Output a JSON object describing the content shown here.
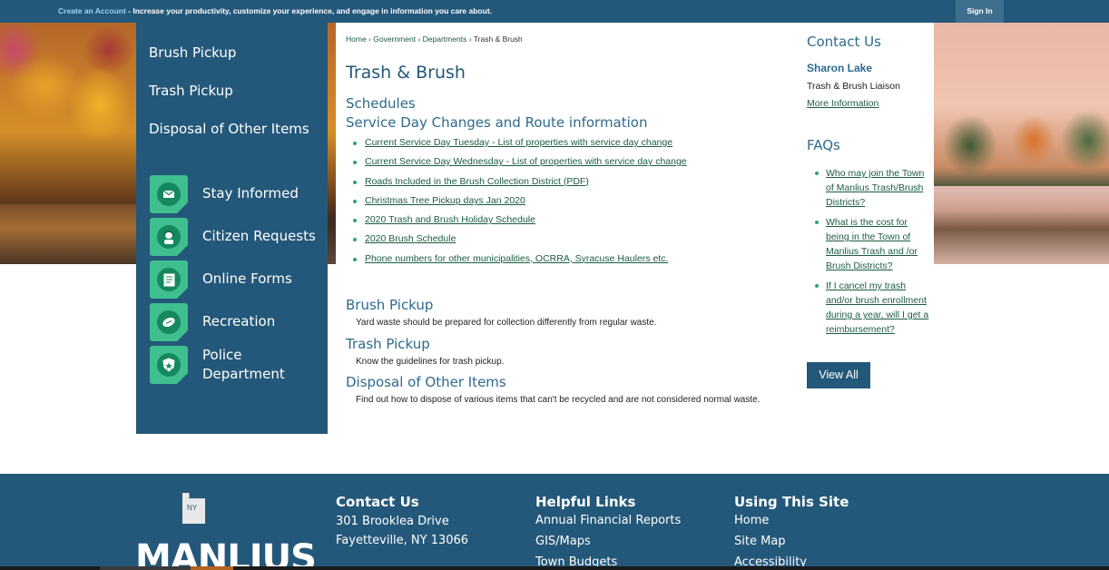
{
  "topbar": {
    "create_account": "Create an Account",
    "message": " - Increase your productivity, customize your experience, and engage in information you care about.",
    "sign_in": "Sign In"
  },
  "sidebar": {
    "links": [
      "Brush Pickup",
      "Trash Pickup",
      "Disposal of Other Items"
    ],
    "quick_links": [
      {
        "label": "Stay Informed",
        "icon": "envelope-icon"
      },
      {
        "label": "Citizen Requests",
        "icon": "headset-icon"
      },
      {
        "label": "Online Forms",
        "icon": "form-icon"
      },
      {
        "label": "Recreation",
        "icon": "football-icon"
      },
      {
        "label": "Police Department",
        "icon": "police-badge-icon"
      }
    ]
  },
  "breadcrumb": {
    "items": [
      "Home",
      "Government",
      "Departments"
    ],
    "current": "Trash & Brush",
    "separator": "›"
  },
  "main": {
    "title": "Trash & Brush",
    "schedules_heading": "Schedules",
    "route_heading": "Service Day Changes and Route information",
    "schedule_links": [
      "Current Service Day Tuesday - List of properties with service day change",
      "Current Service Day Wednesday - List of properties with service day change",
      "Roads Included in the Brush Collection District (PDF)",
      "Christmas Tree Pickup days Jan 2020",
      "2020 Trash and Brush Holiday Schedule",
      "2020 Brush Schedule",
      "Phone numbers for other municipalities, OCRRA, Syracuse Haulers etc."
    ],
    "sections": [
      {
        "heading": "Brush Pickup",
        "text": "Yard waste should be prepared for collection differently from regular waste."
      },
      {
        "heading": "Trash Pickup",
        "text": "Know the guidelines for trash pickup."
      },
      {
        "heading": "Disposal of Other Items",
        "text": "Find out how to dispose of various items that can't be recycled and are not considered normal waste."
      }
    ]
  },
  "contact": {
    "title": "Contact Us",
    "name": "Sharon Lake",
    "role": "Trash & Brush Liaison",
    "more": "More Information"
  },
  "faqs": {
    "title": "FAQs",
    "items": [
      "Who may join the Town of Manlius Trash/Brush Districts?",
      "What is the cost for being in the Town of Manlius Trash and /or Brush Districts?",
      "If I cancel my trash and/or brush enrollment during a year, will I get a reimbursement?"
    ],
    "view_all": "View All"
  },
  "footer": {
    "state_label": "NY",
    "logo_text": "MANLIUS",
    "contact_heading": "Contact Us",
    "address_line1": "301 Brooklea Drive",
    "address_line2": "Fayetteville, NY 13066",
    "helpful_heading": "Helpful Links",
    "helpful_links": [
      "Annual Financial Reports",
      "GIS/Maps",
      "Town Budgets"
    ],
    "using_heading": "Using This Site",
    "using_links": [
      "Home",
      "Site Map",
      "Accessibility"
    ]
  },
  "colors": {
    "brand": "#24587a",
    "link": "#1b5c3f",
    "icon_accent": "#3fbf8f"
  }
}
